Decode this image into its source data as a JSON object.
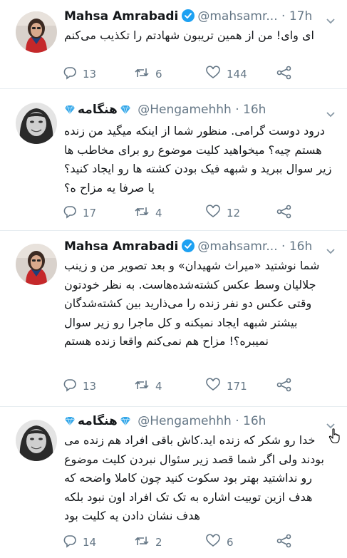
{
  "tweets": [
    {
      "name": "Mahsa Amrabadi",
      "handle": "@mahsamr...",
      "time": "17h",
      "text": "ای وای! من از همین تریبون شهادتم را تکذیب می‌کنم",
      "replies": "13",
      "retweets": "6",
      "likes": "144",
      "verified": true
    },
    {
      "name": "هنگامه",
      "handle": "@Hengamehhh",
      "time": "16h",
      "text": "درود دوست گرامی. منظور شما از اینکه میگید من زنده هستم چیه؟ میخواهید کلیت موضوع رو برای مخاطب ها زیر سوال ببرید و شبهه فیک بودن کشته ها رو ایجاد کنید؟ یا صرفا یه مزاح ه؟",
      "replies": "17",
      "retweets": "4",
      "likes": "12",
      "verified": false
    },
    {
      "name": "Mahsa Amrabadi",
      "handle": "@mahsamr...",
      "time": "16h",
      "text": "شما نوشتید «میراث شهیدان» و بعد تصویر من و زینب جلالیان وسط عکس کشته‌شده‌هاست. به نظر خودتون وقتی عکس دو نفر زنده را می‌ذارید بین کشته‌شدگان بیشتر شبهه ایجاد نمیکنه و کل ماجرا رو زیر سوال نمیبره؟! مزاح هم نمی‌کنم واقعا زنده هستم",
      "replies": "13",
      "retweets": "4",
      "likes": "171",
      "verified": true
    },
    {
      "name": "هنگامه",
      "handle": "@Hengamehhh",
      "time": "16h",
      "text": "خدا رو شکر که زنده اید.کاش باقی افراد هم زنده می بودند ولی اگر شما قصد زیر سئوال نبردن کلیت موضوع رو نداشتید بهتر بود سکوت کنید چون کاملا واضحه که هدف ازین توییت اشاره به تک تک افراد اون نبود بلکه هدف نشان دادن یه کلیت بود",
      "replies": "14",
      "retweets": "2",
      "likes": "6",
      "verified": false
    }
  ],
  "colors": {
    "verified": "#1da1f2",
    "diamond": "#33a6e8",
    "action": "#657786"
  },
  "icons": [
    "verified-badge-icon",
    "diamond-emoji-icon",
    "chevron-down-icon",
    "reply-icon",
    "retweet-icon",
    "like-icon",
    "share-icon",
    "hand-cursor-icon"
  ]
}
